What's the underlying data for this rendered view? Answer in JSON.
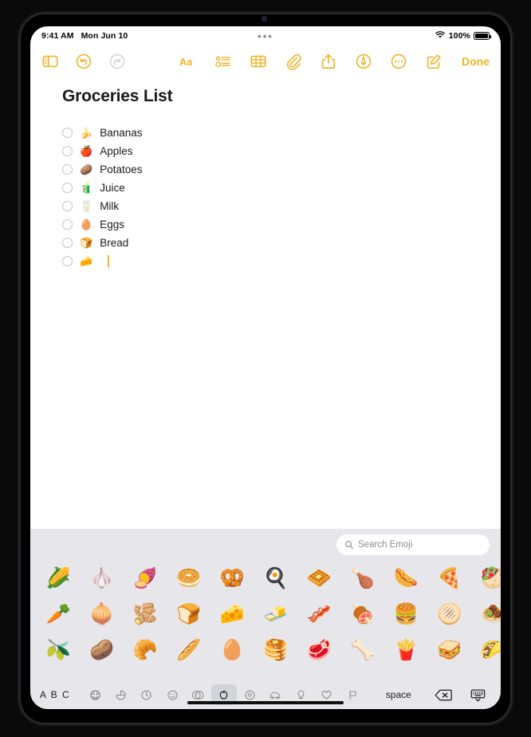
{
  "status_bar": {
    "time": "9:41 AM",
    "date": "Mon Jun 10",
    "center_dots": "•••",
    "wifi_icon": "wifi-icon",
    "battery_percent": "100%",
    "battery_icon": "battery-icon"
  },
  "toolbar": {
    "left": [
      {
        "name": "sidebar-toggle",
        "icon": "sidebar-icon"
      },
      {
        "name": "undo",
        "icon": "undo-icon"
      },
      {
        "name": "redo",
        "icon": "redo-icon"
      }
    ],
    "right": [
      {
        "name": "format",
        "icon": "text-format-icon",
        "label": "Aa"
      },
      {
        "name": "checklist",
        "icon": "checklist-icon"
      },
      {
        "name": "table",
        "icon": "table-icon"
      },
      {
        "name": "attachment",
        "icon": "paperclip-icon"
      },
      {
        "name": "share",
        "icon": "share-icon"
      },
      {
        "name": "markup",
        "icon": "markup-pen-icon"
      },
      {
        "name": "more",
        "icon": "ellipsis-icon"
      },
      {
        "name": "compose",
        "icon": "compose-icon"
      }
    ],
    "done_label": "Done",
    "accent_color": "#F0B323",
    "disabled_color": "#D5D5D7"
  },
  "note": {
    "title": "Groceries List",
    "items": [
      {
        "emoji": "🍌",
        "text": "Bananas",
        "checked": false
      },
      {
        "emoji": "🍎",
        "text": "Apples",
        "checked": false
      },
      {
        "emoji": "🥔",
        "text": "Potatoes",
        "checked": false
      },
      {
        "emoji": "🧃",
        "text": "Juice",
        "checked": false
      },
      {
        "emoji": "🥛",
        "text": "Milk",
        "checked": false
      },
      {
        "emoji": "🥚",
        "text": "Eggs",
        "checked": false
      },
      {
        "emoji": "🍞",
        "text": "Bread",
        "checked": false
      },
      {
        "emoji": "🧀",
        "text": "",
        "checked": false,
        "has_caret": true
      }
    ]
  },
  "keyboard": {
    "search": {
      "placeholder": "Search Emoji",
      "icon": "search-icon",
      "value": ""
    },
    "emoji_rows": [
      [
        "🌽",
        "🧄",
        "🍠",
        "🥯",
        "🥨",
        "🍳",
        "🧇",
        "🍗",
        "🌭",
        "🍕",
        "🥙"
      ],
      [
        "🥕",
        "🧅",
        "🫚",
        "🍞",
        "🧀",
        "🧈",
        "🥓",
        "🍖",
        "🍔",
        "🫓",
        "🧆"
      ],
      [
        "🫒",
        "🥔",
        "🥐",
        "🥖",
        "🥚",
        "🥞",
        "🥩",
        "🦴",
        "🍟",
        "🥪",
        "🌮"
      ]
    ],
    "bottom_bar": {
      "abc_label": "A B C",
      "categories": [
        {
          "name": "frequently-used",
          "icon": "recents-smiley-icon",
          "selected": false
        },
        {
          "name": "stickers",
          "icon": "sticker-icon",
          "selected": false
        },
        {
          "name": "recents",
          "icon": "clock-icon",
          "selected": false
        },
        {
          "name": "smileys",
          "icon": "smiley-icon",
          "selected": false
        },
        {
          "name": "people",
          "icon": "people-icon",
          "selected": false
        },
        {
          "name": "food-drink",
          "icon": "apple-food-icon",
          "selected": true
        },
        {
          "name": "activities",
          "icon": "activity-ball-icon",
          "selected": false
        },
        {
          "name": "travel-places",
          "icon": "car-icon",
          "selected": false
        },
        {
          "name": "objects",
          "icon": "lightbulb-icon",
          "selected": false
        },
        {
          "name": "symbols",
          "icon": "heart-icon",
          "selected": false
        },
        {
          "name": "flags",
          "icon": "flag-icon",
          "selected": false
        }
      ],
      "space_label": "space",
      "delete_icon": "delete-backspace-icon",
      "dismiss_icon": "dismiss-keyboard-icon",
      "selected_bg": "#D3D4DA"
    },
    "background_color": "#E7E7EB"
  }
}
